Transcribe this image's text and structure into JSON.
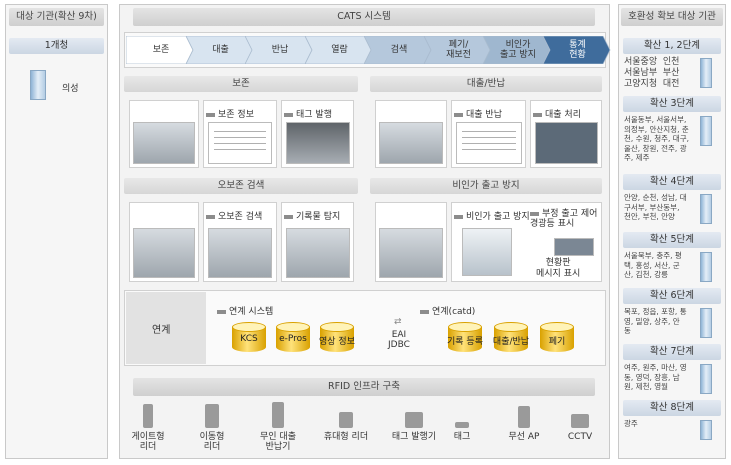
{
  "left_panel": {
    "title": "대상 기관(확산 9차)",
    "stage": "1개청",
    "agency": "의성"
  },
  "center": {
    "title": "CATS 시스템",
    "process_tabs": [
      {
        "label": "보존"
      },
      {
        "label": "대출"
      },
      {
        "label": "반납"
      },
      {
        "label": "열람"
      },
      {
        "label": "검색"
      },
      {
        "label": "폐기/\n재보전"
      },
      {
        "label": "비인가\n출고 방지"
      },
      {
        "label": "통계\n현황"
      }
    ],
    "sections": {
      "preservation": {
        "title": "보존",
        "cards": [
          "보존 정보",
          "태그 발행"
        ]
      },
      "lending": {
        "title": "대출/반납",
        "cards": [
          "대출 반납",
          "대출 처리"
        ]
      },
      "misplaced": {
        "title": "오보존 검색",
        "cards": [
          "오보존 검색",
          "기록물 탐지"
        ]
      },
      "unauthorized": {
        "title": "비인가 출고 방지",
        "cards": [
          "비인가 출고 방지",
          "부정 출고 제어\n경광등 표시",
          "현황판\n메시지 표시"
        ]
      }
    },
    "integration": {
      "label": "연계",
      "systems_title": "연계 시스템",
      "systems": [
        "KCS",
        "e-Pros",
        "영상 정보"
      ],
      "middleware": "EAI\nJDBC",
      "catd_title": "연계(catd)",
      "catd_items": [
        "기록 등록",
        "대출/반납",
        "폐기"
      ]
    }
  },
  "rfid": {
    "title": "RFID 인프라 구축",
    "devices": [
      "게이트형\n리더",
      "이동형\n리더",
      "무인 대출\n반납기",
      "휴대형 리더",
      "태그 발행기",
      "태그",
      "무선 AP",
      "CCTV"
    ]
  },
  "right_panel": {
    "title": "호환성 확보 대상 기관",
    "steps": [
      {
        "label": "확산 1, 2단계",
        "regions": "서울중앙  인천\n서울남부  부산\n고양지청  대전"
      },
      {
        "label": "확산 3단계",
        "regions": "서울동부, 서울서부,\n의정부, 안산지청, 춘\n천, 수원, 청주, 대구,\n울산, 창원, 전주, 광\n주, 제주"
      },
      {
        "label": "확산 4단계",
        "regions": "안양, 순천, 성남, 대\n구서부, 부산동부,\n천안, 부천, 안양"
      },
      {
        "label": "확산 5단계",
        "regions": "서울북부, 충주, 평\n택, 홍성, 서산, 군\n산, 김천, 강릉"
      },
      {
        "label": "확산 6단계",
        "regions": "목포, 정읍, 포항, 통\n영, 밀양, 상주, 안\n동"
      },
      {
        "label": "확산 7단계",
        "regions": "여주, 원주, 마산, 영\n동, 영덕, 장흥, 남\n원, 제천, 영월"
      },
      {
        "label": "확산 8단계",
        "regions": "광주"
      }
    ]
  }
}
